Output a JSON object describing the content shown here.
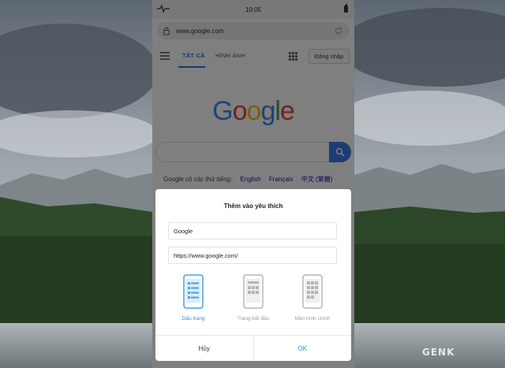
{
  "status_bar": {
    "time": "10:05"
  },
  "browser": {
    "url": "www.google.com"
  },
  "nav": {
    "tabs": [
      {
        "label": "TẤT CẢ",
        "active": true
      },
      {
        "label": "HÌNH ẢNH",
        "active": false
      }
    ],
    "login_label": "Đăng nhập"
  },
  "google": {
    "logo_letters": [
      {
        "char": "G",
        "color": "#4285f4"
      },
      {
        "char": "o",
        "color": "#ea4335"
      },
      {
        "char": "o",
        "color": "#fbbc05"
      },
      {
        "char": "g",
        "color": "#4285f4"
      },
      {
        "char": "l",
        "color": "#34a853"
      },
      {
        "char": "e",
        "color": "#ea4335"
      }
    ],
    "languages_prefix": "Google có các thứ tiếng:",
    "languages": [
      "English",
      "Français",
      "中文 (繁體)"
    ]
  },
  "dialog": {
    "title": "Thêm vào yêu thích",
    "name_value": "Google",
    "url_value": "https://www.google.com/",
    "options": [
      {
        "label": "Dấu trang",
        "icon": "bookmark-list-phone-icon",
        "selected": true
      },
      {
        "label": "Trang bắt đầu",
        "icon": "start-page-phone-icon",
        "selected": false
      },
      {
        "label": "Màn hình chính",
        "icon": "home-screen-phone-icon",
        "selected": false
      }
    ],
    "cancel_label": "Hủy",
    "ok_label": "OK"
  },
  "colors": {
    "accent": "#2f8ad6",
    "search_button": "#3b78e7"
  },
  "watermark": "GENK"
}
